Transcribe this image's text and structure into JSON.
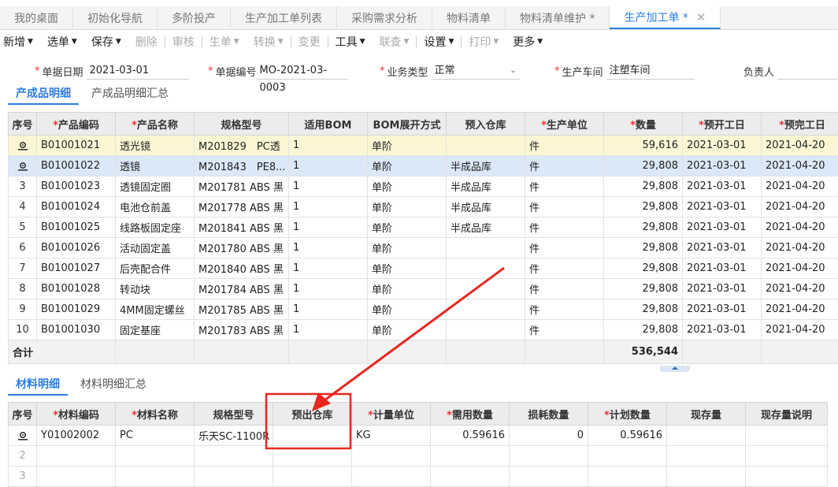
{
  "tabs": [
    {
      "label": "我的桌面",
      "active": false
    },
    {
      "label": "初始化导航",
      "active": false
    },
    {
      "label": "多阶投产",
      "active": false
    },
    {
      "label": "生产加工单列表",
      "active": false
    },
    {
      "label": "采购需求分析",
      "active": false
    },
    {
      "label": "物料清单",
      "active": false
    },
    {
      "label": "物料清单维护 *",
      "active": false
    },
    {
      "label": "生产加工单 *",
      "active": true
    }
  ],
  "toolbar": {
    "new": "新增",
    "select": "选单",
    "save": "保存",
    "delete": "删除",
    "audit": "审核",
    "gen": "生单",
    "convert": "转换",
    "change": "变更",
    "tools": "工具",
    "query": "联查",
    "settings": "设置",
    "print": "打印",
    "more": "更多"
  },
  "form": {
    "date_label": "单据日期",
    "date_value": "2021-03-01",
    "no_label": "单据编号",
    "no_value": "MO-2021-03-0003",
    "type_label": "业务类型",
    "type_value": "正常",
    "workshop_label": "生产车间",
    "workshop_value": "注塑车间",
    "owner_label": "负责人"
  },
  "product_tabs": [
    "产成品明细",
    "产成品明细汇总"
  ],
  "product_table": {
    "headers": [
      "序号",
      "产品编码",
      "产品名称",
      "规格型号",
      "适用BOM",
      "BOM展开方式",
      "预入仓库",
      "生产单位",
      "数量",
      "预开工日",
      "预完工日"
    ],
    "rows": [
      {
        "code": "B01001021",
        "name": "透光镜",
        "spec": "M201829　PC透",
        "bom": "1",
        "mode": "单阶",
        "wh": "",
        "unit": "件",
        "qty": "59,616",
        "start": "2021-03-01",
        "end": "2021-04-20"
      },
      {
        "code": "B01001022",
        "name": "透镜",
        "spec": "M201843　PE8...",
        "bom": "1",
        "mode": "单阶",
        "wh": "半成品库",
        "unit": "件",
        "qty": "29,808",
        "start": "2021-03-01",
        "end": "2021-04-20"
      },
      {
        "idx": "3",
        "code": "B01001023",
        "name": "透镜固定圈",
        "spec": "M201781 ABS 黑",
        "bom": "1",
        "mode": "单阶",
        "wh": "半成品库",
        "unit": "件",
        "qty": "29,808",
        "start": "2021-03-01",
        "end": "2021-04-20"
      },
      {
        "idx": "4",
        "code": "B01001024",
        "name": "电池仓前盖",
        "spec": "M201778 ABS 黑",
        "bom": "1",
        "mode": "单阶",
        "wh": "半成品库",
        "unit": "件",
        "qty": "29,808",
        "start": "2021-03-01",
        "end": "2021-04-20"
      },
      {
        "idx": "5",
        "code": "B01001025",
        "name": "线路板固定座",
        "spec": "M201841 ABS 黑",
        "bom": "1",
        "mode": "单阶",
        "wh": "半成品库",
        "unit": "件",
        "qty": "29,808",
        "start": "2021-03-01",
        "end": "2021-04-20"
      },
      {
        "idx": "6",
        "code": "B01001026",
        "name": "活动固定盖",
        "spec": "M201780 ABS 黑",
        "bom": "1",
        "mode": "单阶",
        "wh": "",
        "unit": "件",
        "qty": "29,808",
        "start": "2021-03-01",
        "end": "2021-04-20"
      },
      {
        "idx": "7",
        "code": "B01001027",
        "name": "后壳配合件",
        "spec": "M201840 ABS 黑",
        "bom": "1",
        "mode": "单阶",
        "wh": "",
        "unit": "件",
        "qty": "29,808",
        "start": "2021-03-01",
        "end": "2021-04-20"
      },
      {
        "idx": "8",
        "code": "B01001028",
        "name": "转动块",
        "spec": "M201784 ABS 黑",
        "bom": "1",
        "mode": "单阶",
        "wh": "",
        "unit": "件",
        "qty": "29,808",
        "start": "2021-03-01",
        "end": "2021-04-20"
      },
      {
        "idx": "9",
        "code": "B01001029",
        "name": "4MM固定螺丝",
        "spec": "M201785 ABS 黑",
        "bom": "1",
        "mode": "单阶",
        "wh": "",
        "unit": "件",
        "qty": "29,808",
        "start": "2021-03-01",
        "end": "2021-04-20"
      },
      {
        "idx": "10",
        "code": "B01001030",
        "name": "固定基座",
        "spec": "M201783 ABS 黑",
        "bom": "1",
        "mode": "单阶",
        "wh": "",
        "unit": "件",
        "qty": "29,808",
        "start": "2021-03-01",
        "end": "2021-04-20"
      }
    ],
    "total_label": "合计",
    "total_qty": "536,544"
  },
  "material_tabs": [
    "材料明细",
    "材料明细汇总"
  ],
  "material_table": {
    "headers": [
      "序号",
      "材料编码",
      "材料名称",
      "规格型号",
      "预出仓库",
      "计量单位",
      "需用数量",
      "损耗数量",
      "计划数量",
      "现存量",
      "现存量说明"
    ],
    "rows": [
      {
        "code": "Y01002002",
        "name": "PC",
        "spec": "乐天SC-1100R",
        "wh": "",
        "unit": "KG",
        "need": "0.59616",
        "loss": "0",
        "plan": "0.59616",
        "stock": "",
        "note": ""
      },
      {
        "idx": "2"
      },
      {
        "idx": "3"
      }
    ]
  },
  "annotation_color": "#e8271f"
}
